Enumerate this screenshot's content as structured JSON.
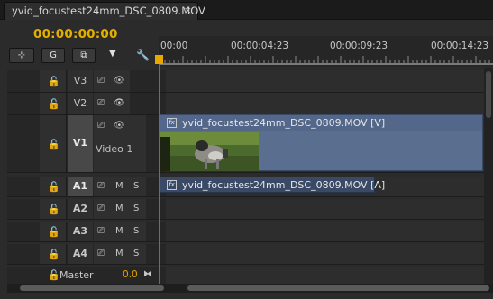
{
  "window": {
    "tab_title": "yvid_focustest24mm_DSC_0809.MOV",
    "close_glyph": "×"
  },
  "timeline": {
    "current_timecode": "00:00:00:00",
    "ruler_labels": [
      "00:00",
      "00:00:04:23",
      "00:00:09:23",
      "00:00:14:23"
    ]
  },
  "toolbar": {
    "tools": [
      {
        "name": "insert-sequence-as-nest-icon",
        "glyph": "⊞"
      },
      {
        "name": "snap-magnet-icon",
        "glyph": "⊂"
      },
      {
        "name": "linked-selection-icon",
        "glyph": "⧉"
      },
      {
        "name": "add-marker-icon",
        "glyph": "▼"
      },
      {
        "name": "wrench-settings-icon",
        "glyph": "🔧"
      }
    ]
  },
  "tracks": {
    "video": [
      {
        "id": "V3",
        "label": ""
      },
      {
        "id": "V2",
        "label": ""
      },
      {
        "id": "V1",
        "label": "Video 1",
        "targeted": true
      }
    ],
    "audio": [
      {
        "id": "A1",
        "mute": "M",
        "solo": "S",
        "targeted": true
      },
      {
        "id": "A2",
        "mute": "M",
        "solo": "S"
      },
      {
        "id": "A3",
        "mute": "M",
        "solo": "S"
      },
      {
        "id": "A4",
        "mute": "M",
        "solo": "S"
      }
    ],
    "master": {
      "label": "Master",
      "value": "0.0"
    }
  },
  "clips": {
    "video_clip": {
      "fx": "fx",
      "label": "yvid_focustest24mm_DSC_0809.MOV [V]"
    },
    "audio_clip": {
      "fx": "fx",
      "label": "yvid_focustest24mm_DSC_0809.MOV [A]"
    }
  },
  "colors": {
    "timecode": "#e3b000",
    "playhead": "#d04a1c",
    "video_clip": "#5a6f8f",
    "audio_clip": "#3a4a66"
  }
}
